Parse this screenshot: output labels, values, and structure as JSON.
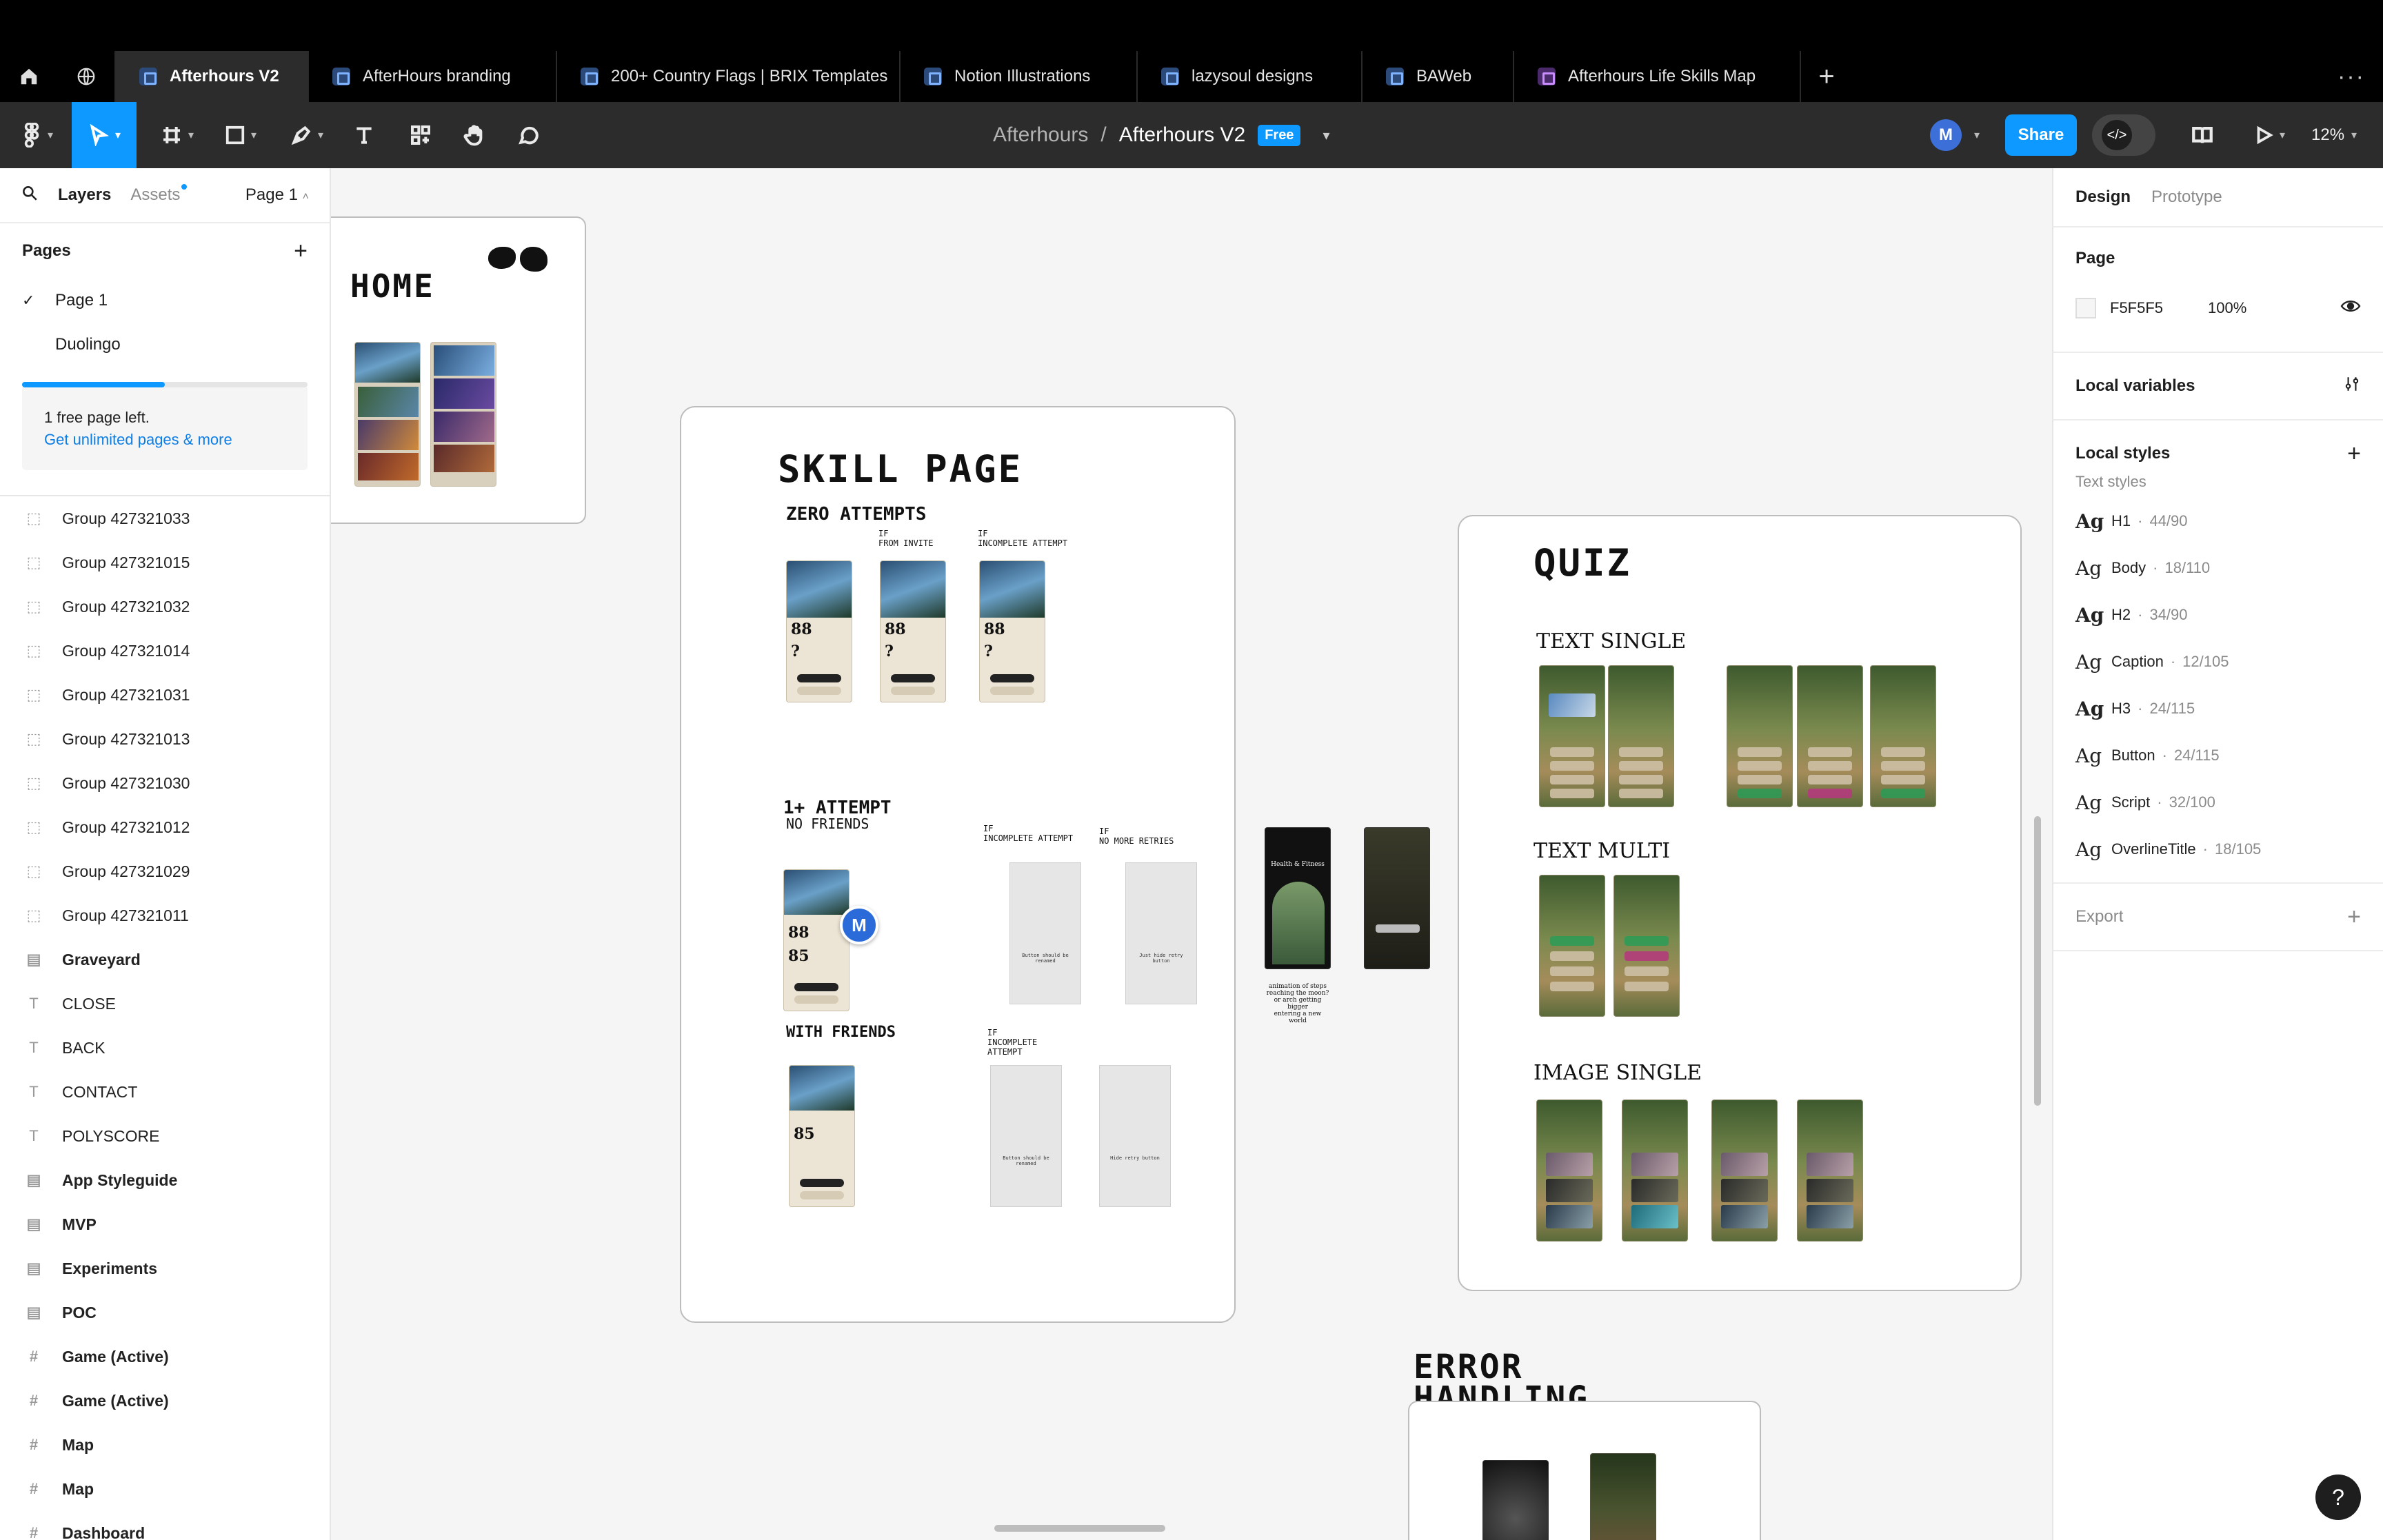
{
  "tabs": [
    {
      "label": "Afterhours V2",
      "active": true
    },
    {
      "label": "AfterHours branding"
    },
    {
      "label": "200+ Country Flags | BRIX Templates"
    },
    {
      "label": "Notion Illustrations"
    },
    {
      "label": "lazysoul designs"
    },
    {
      "label": "BAWeb"
    },
    {
      "label": "Afterhours Life Skills Map"
    }
  ],
  "toolbar": {
    "project": "Afterhours",
    "separator": "/",
    "file": "Afterhours V2",
    "plan_badge": "Free",
    "avatar_initial": "M",
    "share_label": "Share",
    "zoom": "12%"
  },
  "left_panel": {
    "tab_layers": "Layers",
    "tab_assets": "Assets",
    "page_selector": "Page 1",
    "pages_header": "Pages",
    "pages": [
      {
        "name": "Page 1",
        "checked": true
      },
      {
        "name": "Duolingo",
        "checked": false
      }
    ],
    "free_pages_progress": 0.5,
    "upsell_text": "1 free page left.",
    "upsell_link": "Get unlimited pages & more",
    "layers": [
      {
        "name": "Group 427321033",
        "icon": "group-icon"
      },
      {
        "name": "Group 427321015",
        "icon": "group-icon"
      },
      {
        "name": "Group 427321032",
        "icon": "group-icon"
      },
      {
        "name": "Group 427321014",
        "icon": "group-icon"
      },
      {
        "name": "Group 427321031",
        "icon": "group-icon"
      },
      {
        "name": "Group 427321013",
        "icon": "group-icon"
      },
      {
        "name": "Group 427321030",
        "icon": "group-icon"
      },
      {
        "name": "Group 427321012",
        "icon": "group-icon"
      },
      {
        "name": "Group 427321029",
        "icon": "group-icon"
      },
      {
        "name": "Group 427321011",
        "icon": "group-icon"
      },
      {
        "name": "Graveyard",
        "icon": "section-icon",
        "bold": true
      },
      {
        "name": "CLOSE",
        "icon": "text-icon"
      },
      {
        "name": "BACK",
        "icon": "text-icon"
      },
      {
        "name": "CONTACT",
        "icon": "text-icon"
      },
      {
        "name": "POLYSCORE",
        "icon": "text-icon"
      },
      {
        "name": "App Styleguide",
        "icon": "section-icon",
        "bold": true
      },
      {
        "name": "MVP",
        "icon": "section-icon",
        "bold": true
      },
      {
        "name": "Experiments",
        "icon": "section-icon",
        "bold": true
      },
      {
        "name": "POC",
        "icon": "section-icon",
        "bold": true
      },
      {
        "name": "Game (Active)",
        "icon": "frame-icon",
        "bold": true
      },
      {
        "name": "Game (Active)",
        "icon": "frame-icon",
        "bold": true
      },
      {
        "name": "Map",
        "icon": "frame-icon",
        "bold": true
      },
      {
        "name": "Map",
        "icon": "frame-icon",
        "bold": true
      },
      {
        "name": "Dashboard",
        "icon": "frame-icon",
        "bold": true
      }
    ]
  },
  "canvas": {
    "home": {
      "title": "HOME"
    },
    "skill": {
      "title": "SKILL PAGE",
      "zero": "ZERO ATTEMPTS",
      "if_invite": "IF\nFROM INVITE",
      "if_incomplete": "IF\nINCOMPLETE ATTEMPT",
      "one_plus": "1+ ATTEMPT",
      "no_friends": "NO FRIENDS",
      "with_friends": "WITH FRIENDS",
      "if_incomplete2": "IF\nINCOMPLETE ATTEMPT",
      "if_no_retries": "IF\nNO MORE RETRIES",
      "if_incomplete3": "IF\nINCOMPLETE\nATTEMPT",
      "phone_title": "Health & Fitness",
      "score1": "88",
      "score_q": "?",
      "score2": "85"
    },
    "middle_caption": "animation of steps reaching the moon? or arch getting bigger\nentering a new world",
    "middle_phone_title": "Health & Fitness",
    "quiz": {
      "title": "QUIZ",
      "text_single": "TEXT SINGLE",
      "text_multi": "TEXT MULTI",
      "image_single": "IMAGE SINGLE"
    },
    "error": {
      "title": "ERROR\nHANDLING"
    },
    "cursor_initial": "M"
  },
  "right_panel": {
    "tab_design": "Design",
    "tab_prototype": "Prototype",
    "page_header": "Page",
    "page_color": "F5F5F5",
    "page_opacity": "100%",
    "local_variables": "Local variables",
    "local_styles": "Local styles",
    "text_styles_label": "Text styles",
    "text_styles": [
      {
        "name": "H1",
        "meta": "44/90",
        "weight": "bold"
      },
      {
        "name": "Body",
        "meta": "18/110"
      },
      {
        "name": "H2",
        "meta": "34/90",
        "weight": "bold"
      },
      {
        "name": "Caption",
        "meta": "12/105"
      },
      {
        "name": "H3",
        "meta": "24/115",
        "weight": "bold"
      },
      {
        "name": "Button",
        "meta": "24/115"
      },
      {
        "name": "Script",
        "meta": "32/100"
      },
      {
        "name": "OverlineTitle",
        "meta": "18/105"
      }
    ],
    "export_label": "Export"
  }
}
